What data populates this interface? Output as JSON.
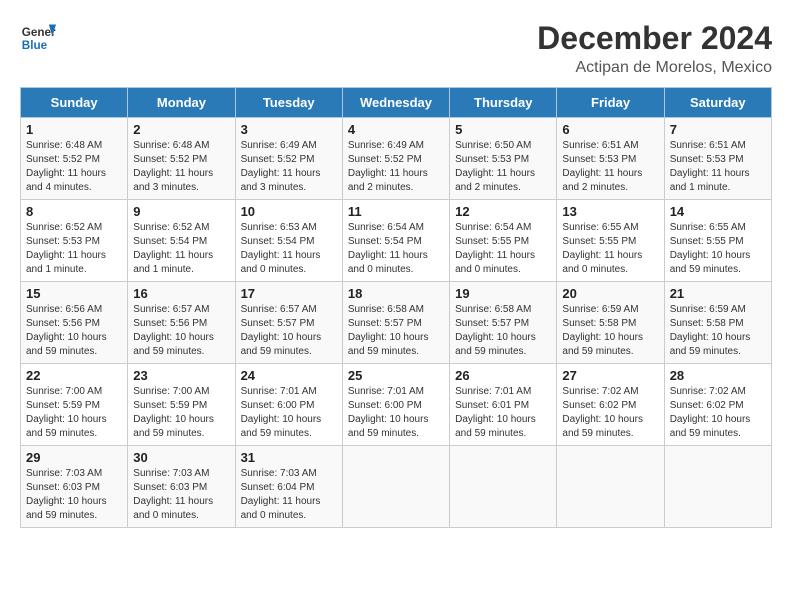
{
  "header": {
    "logo_line1": "General",
    "logo_line2": "Blue",
    "title": "December 2024",
    "subtitle": "Actipan de Morelos, Mexico"
  },
  "calendar": {
    "days_of_week": [
      "Sunday",
      "Monday",
      "Tuesday",
      "Wednesday",
      "Thursday",
      "Friday",
      "Saturday"
    ],
    "weeks": [
      [
        null,
        {
          "day": 2,
          "sunrise": "6:48 AM",
          "sunset": "5:52 PM",
          "daylight": "11 hours and 3 minutes."
        },
        {
          "day": 3,
          "sunrise": "6:49 AM",
          "sunset": "5:52 PM",
          "daylight": "11 hours and 3 minutes."
        },
        {
          "day": 4,
          "sunrise": "6:49 AM",
          "sunset": "5:52 PM",
          "daylight": "11 hours and 2 minutes."
        },
        {
          "day": 5,
          "sunrise": "6:50 AM",
          "sunset": "5:53 PM",
          "daylight": "11 hours and 2 minutes."
        },
        {
          "day": 6,
          "sunrise": "6:51 AM",
          "sunset": "5:53 PM",
          "daylight": "11 hours and 2 minutes."
        },
        {
          "day": 7,
          "sunrise": "6:51 AM",
          "sunset": "5:53 PM",
          "daylight": "11 hours and 1 minute."
        }
      ],
      [
        {
          "day": 1,
          "sunrise": "6:48 AM",
          "sunset": "5:52 PM",
          "daylight": "11 hours and 4 minutes."
        },
        null,
        null,
        null,
        null,
        null,
        null
      ],
      [
        {
          "day": 8,
          "sunrise": "6:52 AM",
          "sunset": "5:53 PM",
          "daylight": "11 hours and 1 minute."
        },
        {
          "day": 9,
          "sunrise": "6:52 AM",
          "sunset": "5:54 PM",
          "daylight": "11 hours and 1 minute."
        },
        {
          "day": 10,
          "sunrise": "6:53 AM",
          "sunset": "5:54 PM",
          "daylight": "11 hours and 0 minutes."
        },
        {
          "day": 11,
          "sunrise": "6:54 AM",
          "sunset": "5:54 PM",
          "daylight": "11 hours and 0 minutes."
        },
        {
          "day": 12,
          "sunrise": "6:54 AM",
          "sunset": "5:55 PM",
          "daylight": "11 hours and 0 minutes."
        },
        {
          "day": 13,
          "sunrise": "6:55 AM",
          "sunset": "5:55 PM",
          "daylight": "11 hours and 0 minutes."
        },
        {
          "day": 14,
          "sunrise": "6:55 AM",
          "sunset": "5:55 PM",
          "daylight": "10 hours and 59 minutes."
        }
      ],
      [
        {
          "day": 15,
          "sunrise": "6:56 AM",
          "sunset": "5:56 PM",
          "daylight": "10 hours and 59 minutes."
        },
        {
          "day": 16,
          "sunrise": "6:57 AM",
          "sunset": "5:56 PM",
          "daylight": "10 hours and 59 minutes."
        },
        {
          "day": 17,
          "sunrise": "6:57 AM",
          "sunset": "5:57 PM",
          "daylight": "10 hours and 59 minutes."
        },
        {
          "day": 18,
          "sunrise": "6:58 AM",
          "sunset": "5:57 PM",
          "daylight": "10 hours and 59 minutes."
        },
        {
          "day": 19,
          "sunrise": "6:58 AM",
          "sunset": "5:57 PM",
          "daylight": "10 hours and 59 minutes."
        },
        {
          "day": 20,
          "sunrise": "6:59 AM",
          "sunset": "5:58 PM",
          "daylight": "10 hours and 59 minutes."
        },
        {
          "day": 21,
          "sunrise": "6:59 AM",
          "sunset": "5:58 PM",
          "daylight": "10 hours and 59 minutes."
        }
      ],
      [
        {
          "day": 22,
          "sunrise": "7:00 AM",
          "sunset": "5:59 PM",
          "daylight": "10 hours and 59 minutes."
        },
        {
          "day": 23,
          "sunrise": "7:00 AM",
          "sunset": "5:59 PM",
          "daylight": "10 hours and 59 minutes."
        },
        {
          "day": 24,
          "sunrise": "7:01 AM",
          "sunset": "6:00 PM",
          "daylight": "10 hours and 59 minutes."
        },
        {
          "day": 25,
          "sunrise": "7:01 AM",
          "sunset": "6:00 PM",
          "daylight": "10 hours and 59 minutes."
        },
        {
          "day": 26,
          "sunrise": "7:01 AM",
          "sunset": "6:01 PM",
          "daylight": "10 hours and 59 minutes."
        },
        {
          "day": 27,
          "sunrise": "7:02 AM",
          "sunset": "6:02 PM",
          "daylight": "10 hours and 59 minutes."
        },
        {
          "day": 28,
          "sunrise": "7:02 AM",
          "sunset": "6:02 PM",
          "daylight": "10 hours and 59 minutes."
        }
      ],
      [
        {
          "day": 29,
          "sunrise": "7:03 AM",
          "sunset": "6:03 PM",
          "daylight": "10 hours and 59 minutes."
        },
        {
          "day": 30,
          "sunrise": "7:03 AM",
          "sunset": "6:03 PM",
          "daylight": "11 hours and 0 minutes."
        },
        {
          "day": 31,
          "sunrise": "7:03 AM",
          "sunset": "6:04 PM",
          "daylight": "11 hours and 0 minutes."
        },
        null,
        null,
        null,
        null
      ]
    ]
  }
}
